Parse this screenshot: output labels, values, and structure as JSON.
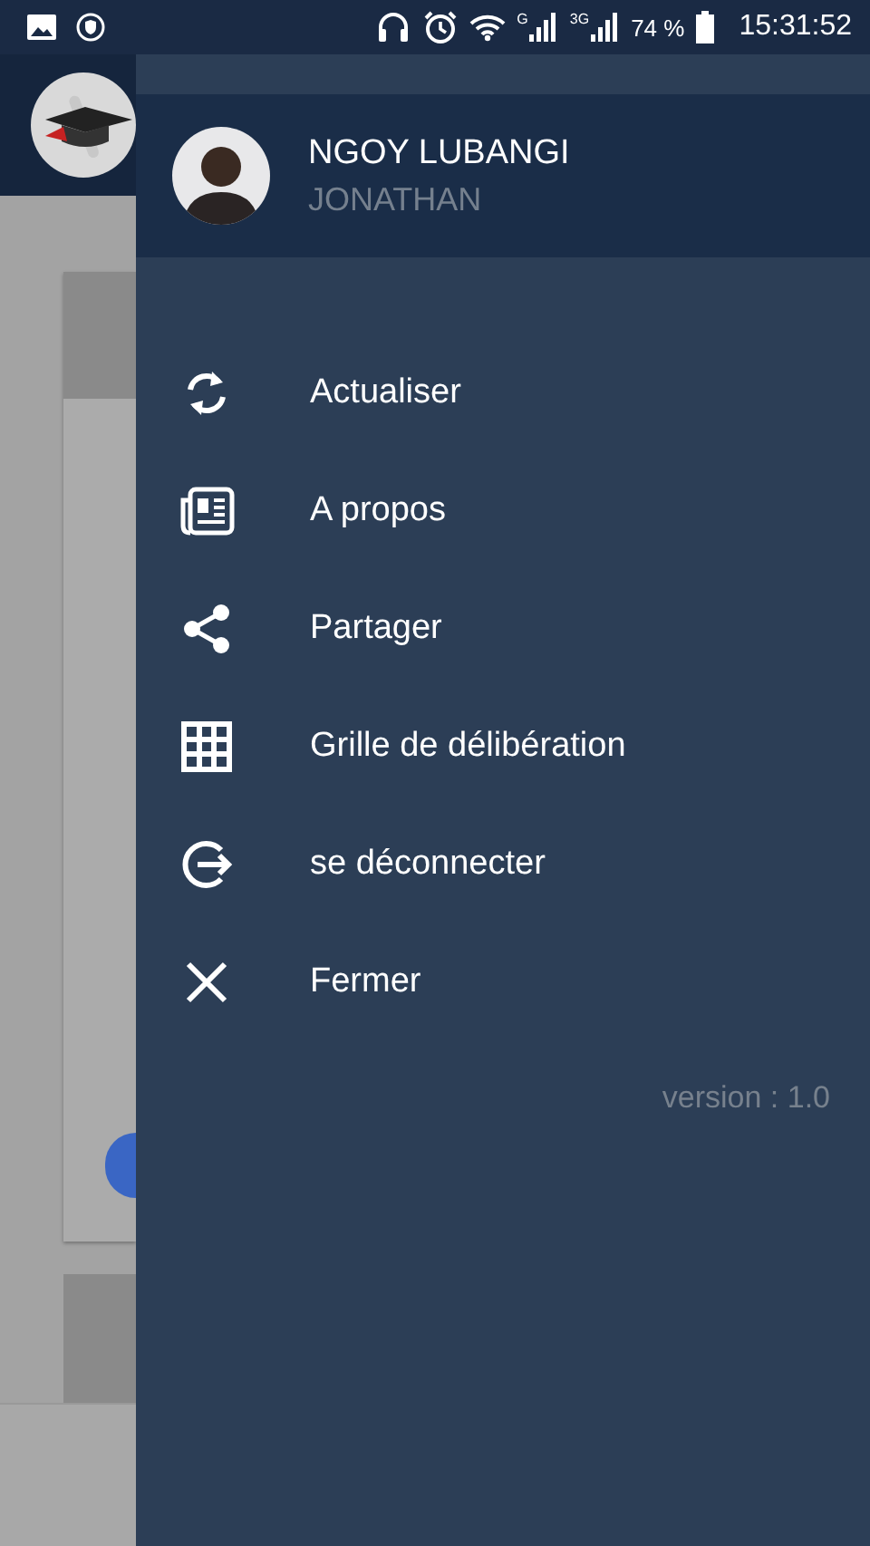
{
  "status_bar": {
    "network_labels": [
      "G",
      "3G"
    ],
    "battery": "74 %",
    "time": "15:31:52"
  },
  "drawer": {
    "user": {
      "name": "NGOY LUBANGI",
      "subtitle": "JONATHAN"
    },
    "menu": [
      {
        "label": "Actualiser"
      },
      {
        "label": "A propos"
      },
      {
        "label": "Partager"
      },
      {
        "label": "Grille de délibération"
      },
      {
        "label": "se déconnecter"
      },
      {
        "label": "Fermer"
      }
    ],
    "version": "version : 1.0"
  }
}
